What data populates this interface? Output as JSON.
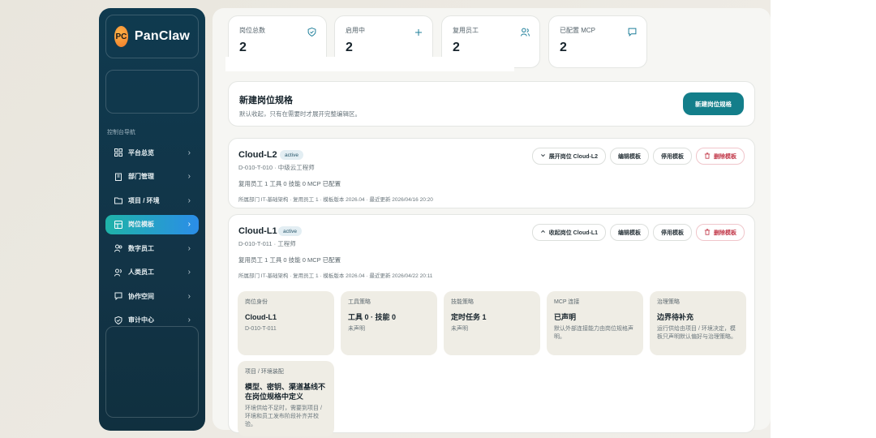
{
  "brand": {
    "logo": "PC",
    "name": "PanClaw"
  },
  "nav": {
    "caption": "控制台导航",
    "items": [
      {
        "label": "平台总览",
        "icon": "grid-icon"
      },
      {
        "label": "部门管理",
        "icon": "building-icon"
      },
      {
        "label": "项目 / 环境",
        "icon": "folder-icon"
      },
      {
        "label": "岗位模板",
        "icon": "template-icon",
        "active": true
      },
      {
        "label": "数字员工",
        "icon": "users-icon"
      },
      {
        "label": "人类员工",
        "icon": "people-icon"
      },
      {
        "label": "协作空间",
        "icon": "chat-icon"
      },
      {
        "label": "审计中心",
        "icon": "shield-icon"
      }
    ]
  },
  "stats": [
    {
      "label": "岗位总数",
      "value": "2",
      "icon": "shield-check-icon"
    },
    {
      "label": "启用中",
      "value": "2",
      "icon": "plus-icon"
    },
    {
      "label": "复用员工",
      "value": "2",
      "icon": "users-icon"
    },
    {
      "label": "已配置 MCP",
      "value": "2",
      "icon": "message-icon"
    }
  ],
  "create": {
    "title": "新建岗位规格",
    "subtitle": "默认收起，只有在需要时才展开完整编辑区。",
    "button": "新建岗位规格"
  },
  "cards": [
    {
      "name": "Cloud-L2",
      "status": "active",
      "code": "D-010-T-010 · 中级云工程师",
      "toggle": "展开岗位 Cloud-L2",
      "edit": "编辑模板",
      "disable": "停用模板",
      "delete": "删除模板",
      "meta1": "复用员工 1 工具 0 技能 0 MCP 已配置",
      "meta2": "所属部门 IT-基础架构 · 复用员工 1 · 模板版本 2026.04 · 最近更新 2026/04/16 20:20"
    },
    {
      "name": "Cloud-L1",
      "status": "active",
      "code": "D-010-T-011 · 工程师",
      "toggle": "收起岗位 Cloud-L1",
      "edit": "编辑模板",
      "disable": "停用模板",
      "delete": "删除模板",
      "meta1": "复用员工 1 工具 0 技能 0 MCP 已配置",
      "meta2": "所属部门 IT-基础架构 · 复用员工 1 · 模板版本 2026.04 · 最近更新 2026/04/22 20:11",
      "details": [
        {
          "h": "岗位身份",
          "b": "Cloud-L1",
          "d": "D-010-T-011"
        },
        {
          "h": "工具策略",
          "b": "工具 0 · 技能 0",
          "d": "未声明"
        },
        {
          "h": "技能策略",
          "b": "定时任务 1",
          "d": "未声明"
        },
        {
          "h": "MCP 连接",
          "b": "已声明",
          "d": "默认外部连接能力由岗位规格声明。"
        },
        {
          "h": "治理策略",
          "b": "边界待补充",
          "d": "运行供给由项目 / 环境决定，模板只声明默认偏好与治理策略。"
        },
        {
          "h": "项目 / 环境装配",
          "b": "模型、密钥、渠道基线不在岗位规格中定义",
          "d": "环境供给不足时，需要到项目 / 环境和员工发布阶段补齐并校验。"
        }
      ]
    }
  ],
  "colors": {
    "accent": "#137e8a",
    "sidebar": "#0f3a4f",
    "danger": "#c2394a"
  }
}
